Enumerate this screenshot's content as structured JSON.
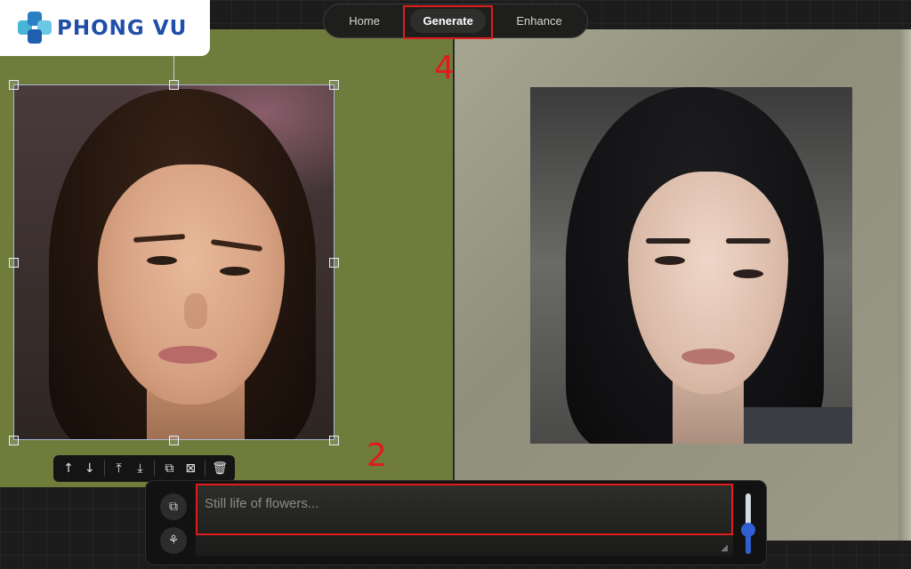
{
  "brand": {
    "name": "PHONG VU",
    "text_color": "#1f4fa8",
    "mark_colors": [
      "#49b6d8",
      "#2a7ec4",
      "#6cc9e6",
      "#1f5fb0"
    ]
  },
  "nav": {
    "items": [
      {
        "label": "Home",
        "active": false
      },
      {
        "label": "Generate",
        "active": true
      },
      {
        "label": "Enhance",
        "active": false
      }
    ]
  },
  "annotations": {
    "generate_step": "4",
    "prompt_step": "2",
    "color": "#e11b1b"
  },
  "canvas": {
    "left_bg": "#6f7c3c",
    "right_bg": "#9a9a86"
  },
  "mini_toolbar": {
    "icons": [
      "arrow-up-icon",
      "arrow-down-icon",
      "bring-to-front-icon",
      "send-to-back-icon",
      "duplicate-icon",
      "remove-background-icon",
      "trash-icon"
    ]
  },
  "prompt": {
    "placeholder": "Still life of flowers...",
    "value": ""
  },
  "side_buttons": [
    "shapes-icon",
    "plant-icon"
  ],
  "strength_slider": {
    "value": 0.4,
    "color": "#2f5fd0"
  }
}
